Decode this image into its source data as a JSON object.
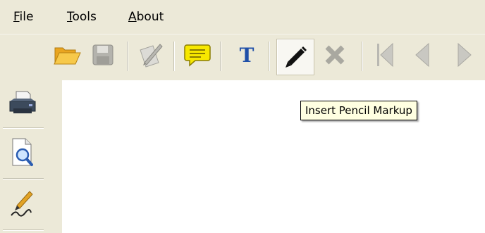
{
  "menubar": {
    "items": [
      {
        "first": "F",
        "rest": "ile"
      },
      {
        "first": "T",
        "rest": "ools"
      },
      {
        "first": "A",
        "rest": "bout"
      }
    ]
  },
  "toolbar": {
    "buttons": [
      {
        "icon": "folder-open-icon",
        "enabled": true
      },
      {
        "icon": "save-icon",
        "enabled": false
      },
      {
        "icon": "sign-icon",
        "enabled": false
      },
      {
        "icon": "comment-icon",
        "enabled": true
      },
      {
        "icon": "text-icon",
        "enabled": true,
        "glyph": "T"
      },
      {
        "icon": "pencil-icon",
        "enabled": true,
        "active": true
      },
      {
        "icon": "delete-icon",
        "enabled": false
      },
      {
        "icon": "first-page-icon",
        "enabled": false
      },
      {
        "icon": "previous-page-icon",
        "enabled": false
      },
      {
        "icon": "next-page-icon",
        "enabled": false
      }
    ]
  },
  "sidebar": {
    "buttons": [
      {
        "icon": "printer-icon"
      },
      {
        "icon": "print-preview-icon"
      },
      {
        "icon": "signature-icon"
      }
    ]
  },
  "tooltip": {
    "text": "Insert Pencil Markup"
  },
  "colors": {
    "chrome": "#ece9d8",
    "tooltip_bg": "#ffffe1",
    "accent_blue": "#1f4fa8",
    "folder_yellow": "#f2b632",
    "comment_yellow": "#f7e800",
    "disabled_gray": "#a9a8a0"
  }
}
